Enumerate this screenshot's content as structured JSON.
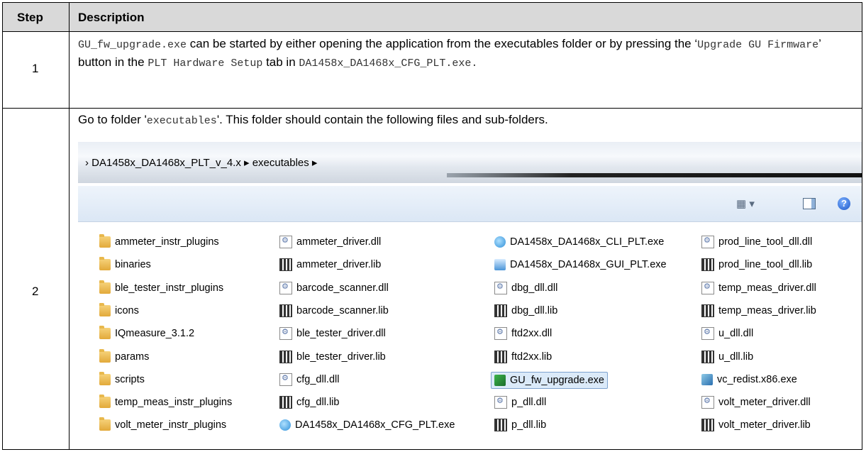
{
  "table": {
    "header_step": "Step",
    "header_description": "Description",
    "rows": [
      {
        "step": "1",
        "parts": [
          {
            "text": "GU_fw_upgrade.exe",
            "mono": true
          },
          {
            "text": " can be started by either opening the application from the executables folder or by pressing the ‘",
            "mono": false
          },
          {
            "text": "Upgrade GU Firmware",
            "mono": true
          },
          {
            "text": "’ button in the ",
            "mono": false
          },
          {
            "text": "PLT Hardware Setup",
            "mono": true
          },
          {
            "text": " tab in ",
            "mono": false
          },
          {
            "text": "DA1458x_DA1468x_CFG_PLT.exe.",
            "mono": true
          }
        ]
      },
      {
        "step": "2",
        "intro_prefix": "Go to folder '",
        "intro_folder": "executables",
        "intro_suffix": "'. This folder should contain the following files and sub-folders."
      }
    ]
  },
  "explorer": {
    "breadcrumb": "› DA1458x_DA1468x_PLT_v_4.x ▸ executables ▸",
    "columns": [
      [
        {
          "name": "ammeter_instr_plugins",
          "icon": "folder"
        },
        {
          "name": "binaries",
          "icon": "folder"
        },
        {
          "name": "ble_tester_instr_plugins",
          "icon": "folder"
        },
        {
          "name": "icons",
          "icon": "folder"
        },
        {
          "name": "IQmeasure_3.1.2",
          "icon": "folder"
        },
        {
          "name": "params",
          "icon": "folder"
        },
        {
          "name": "scripts",
          "icon": "folder"
        },
        {
          "name": "temp_meas_instr_plugins",
          "icon": "folder"
        },
        {
          "name": "volt_meter_instr_plugins",
          "icon": "folder"
        }
      ],
      [
        {
          "name": "ammeter_driver.dll",
          "icon": "dll"
        },
        {
          "name": "ammeter_driver.lib",
          "icon": "lib"
        },
        {
          "name": "barcode_scanner.dll",
          "icon": "dll"
        },
        {
          "name": "barcode_scanner.lib",
          "icon": "lib"
        },
        {
          "name": "ble_tester_driver.dll",
          "icon": "dll"
        },
        {
          "name": "ble_tester_driver.lib",
          "icon": "lib"
        },
        {
          "name": "cfg_dll.dll",
          "icon": "dll"
        },
        {
          "name": "cfg_dll.lib",
          "icon": "lib"
        },
        {
          "name": "DA1458x_DA1468x_CFG_PLT.exe",
          "icon": "exe"
        }
      ],
      [
        {
          "name": "DA1458x_DA1468x_CLI_PLT.exe",
          "icon": "exe"
        },
        {
          "name": "DA1458x_DA1468x_GUI_PLT.exe",
          "icon": "exe2"
        },
        {
          "name": "dbg_dll.dll",
          "icon": "dll"
        },
        {
          "name": "dbg_dll.lib",
          "icon": "lib"
        },
        {
          "name": "ftd2xx.dll",
          "icon": "dll"
        },
        {
          "name": "ftd2xx.lib",
          "icon": "lib"
        },
        {
          "name": "GU_fw_upgrade.exe",
          "icon": "gu",
          "selected": true
        },
        {
          "name": "p_dll.dll",
          "icon": "dll"
        },
        {
          "name": "p_dll.lib",
          "icon": "lib"
        }
      ],
      [
        {
          "name": "prod_line_tool_dll.dll",
          "icon": "dll"
        },
        {
          "name": "prod_line_tool_dll.lib",
          "icon": "lib"
        },
        {
          "name": "temp_meas_driver.dll",
          "icon": "dll"
        },
        {
          "name": "temp_meas_driver.lib",
          "icon": "lib"
        },
        {
          "name": "u_dll.dll",
          "icon": "dll"
        },
        {
          "name": "u_dll.lib",
          "icon": "lib"
        },
        {
          "name": "vc_redist.x86.exe",
          "icon": "vc"
        },
        {
          "name": "volt_meter_driver.dll",
          "icon": "dll"
        },
        {
          "name": "volt_meter_driver.lib",
          "icon": "lib"
        }
      ]
    ]
  }
}
